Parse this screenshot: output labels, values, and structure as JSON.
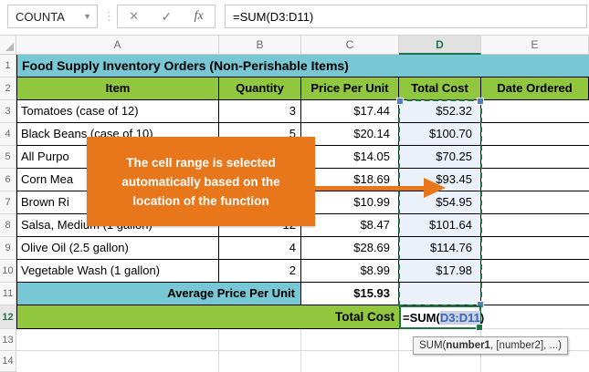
{
  "colors": {
    "teal_band": "#77C7D4",
    "green_band": "#90C73E",
    "callout_orange": "#E8761A",
    "selection_fill": "#EAF1FA",
    "marching_ants_green": "#1E7145",
    "edit_border_green": "#217346",
    "range_text_blue": "#3565BE"
  },
  "formula_bar": {
    "name_box_value": "COUNTA",
    "dropdown_icon": "▼",
    "separator_icon": "⋮",
    "cancel_icon": "✕",
    "enter_icon": "✓",
    "fx_icon": "fx",
    "formula": "=SUM(D3:D11)"
  },
  "column_headers": [
    "A",
    "B",
    "C",
    "D",
    "E"
  ],
  "selected_column": "D",
  "row_headers": [
    "1",
    "2",
    "3",
    "4",
    "5",
    "6",
    "7",
    "8",
    "9",
    "10",
    "11",
    "12",
    "13",
    "14"
  ],
  "active_row": "12",
  "sheet": {
    "title": "Food Supply Inventory Orders (Non-Perishable Items)",
    "headers": {
      "item": "Item",
      "quantity": "Quantity",
      "price": "Price Per Unit",
      "total": "Total Cost",
      "date": "Date Ordered"
    },
    "rows": [
      {
        "row": "3",
        "item": "Tomatoes (case of 12)",
        "qty": "3",
        "price": "$17.44",
        "total": "$52.32"
      },
      {
        "row": "4",
        "item": "Black Beans (case of 10)",
        "qty": "5",
        "price": "$20.14",
        "total": "$100.70"
      },
      {
        "row": "5",
        "item": "All Purpo",
        "qty": "",
        "price": "$14.05",
        "total": "$70.25"
      },
      {
        "row": "6",
        "item": "Corn Mea",
        "qty": "",
        "price": "$18.69",
        "total": "$93.45"
      },
      {
        "row": "7",
        "item": "Brown Ri",
        "qty": "",
        "price": "$10.99",
        "total": "$54.95"
      },
      {
        "row": "8",
        "item": "Salsa, Medium (1 gallon)",
        "qty": "12",
        "price": "$8.47",
        "total": "$101.64"
      },
      {
        "row": "9",
        "item": "Olive Oil (2.5 gallon)",
        "qty": "4",
        "price": "$28.69",
        "total": "$114.76"
      },
      {
        "row": "10",
        "item": "Vegetable Wash (1 gallon)",
        "qty": "2",
        "price": "$8.99",
        "total": "$17.98"
      }
    ],
    "average_label": "Average Price Per Unit",
    "average_value": "$15.93",
    "total_label": "Total Cost",
    "edit_formula": {
      "prefix": "=SUM(",
      "range": "D3:D11",
      "suffix": ")"
    }
  },
  "callout": {
    "line1": "The cell range is selected",
    "line2": "automatically based on the",
    "line3": "location of the function"
  },
  "screentip": {
    "prefix": "SUM(",
    "bold": "number1",
    "suffix": ", [number2], ...)"
  }
}
